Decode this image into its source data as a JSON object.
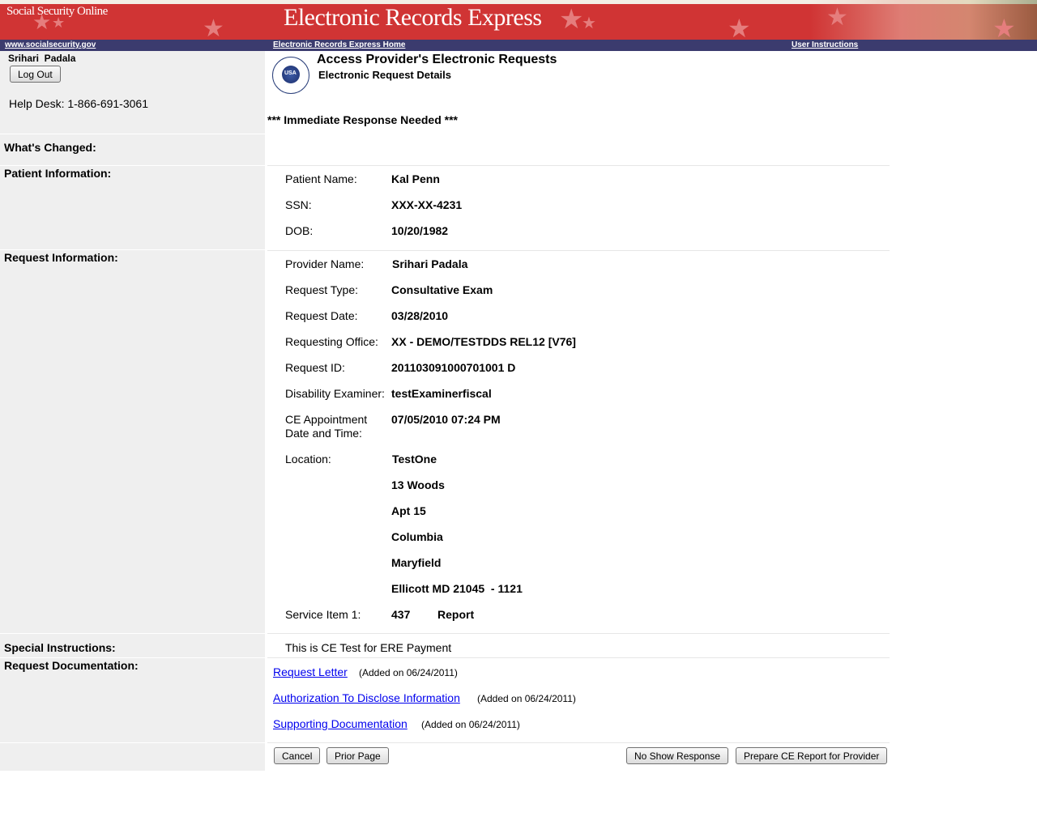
{
  "header": {
    "site_name": "Social Security Online",
    "app_title": "Electronic Records Express"
  },
  "nav": {
    "home_link": "www.socialsecurity.gov",
    "ere_home_link": "Electronic Records Express Home",
    "instructions_link": "User Instructions"
  },
  "user": {
    "name": "Srihari  Padala",
    "logout_label": "Log Out",
    "help_desk": "Help Desk: 1-866-691-3061"
  },
  "page": {
    "title": "Access Provider's Electronic Requests",
    "subtitle": "Electronic Request Details",
    "alert": "*** Immediate Response Needed ***"
  },
  "sections": {
    "whats_changed": "What's Changed:",
    "patient_info": "Patient Information:",
    "request_info": "Request Information:",
    "special_instructions": "Special Instructions:",
    "request_documentation": "Request Documentation:"
  },
  "patient": {
    "name_label": "Patient Name:",
    "name": "Kal Penn",
    "ssn_label": "SSN:",
    "ssn": "XXX-XX-4231",
    "dob_label": "DOB:",
    "dob": "10/20/1982"
  },
  "request": {
    "provider_label": "Provider Name:",
    "provider": "Srihari Padala",
    "type_label": "Request Type:",
    "type": "Consultative Exam",
    "date_label": "Request Date:",
    "date": "03/28/2010",
    "office_label": "Requesting Office:",
    "office": "XX - DEMO/TESTDDS REL12 [V76]",
    "id_label": "Request ID:",
    "id": "201103091000701001 D",
    "examiner_label": "Disability Examiner:",
    "examiner": "testExaminerfiscal",
    "appt_label_line1": "CE Appointment",
    "appt_label_line2": "Date and Time:",
    "appt": "07/05/2010 07:24 PM",
    "location_label": "Location:",
    "location": [
      "TestOne",
      "13 Woods",
      "Apt 15",
      "Columbia",
      "Maryfield",
      "Ellicott MD 21045  - 1121"
    ],
    "service_label": "Service Item 1:",
    "service_code": "437",
    "service_name": "Report"
  },
  "special_instructions_text": "This is CE Test for ERE Payment",
  "documents": [
    {
      "label": "Request Letter",
      "added": "(Added on 06/24/2011)"
    },
    {
      "label": "Authorization To Disclose Information",
      "added": "(Added on 06/24/2011)"
    },
    {
      "label": "Supporting Documentation",
      "added": "(Added on 06/24/2011)"
    }
  ],
  "buttons": {
    "cancel": "Cancel",
    "prior_page": "Prior Page",
    "no_show": "No Show Response",
    "prepare_ce": "Prepare CE Report for Provider"
  }
}
